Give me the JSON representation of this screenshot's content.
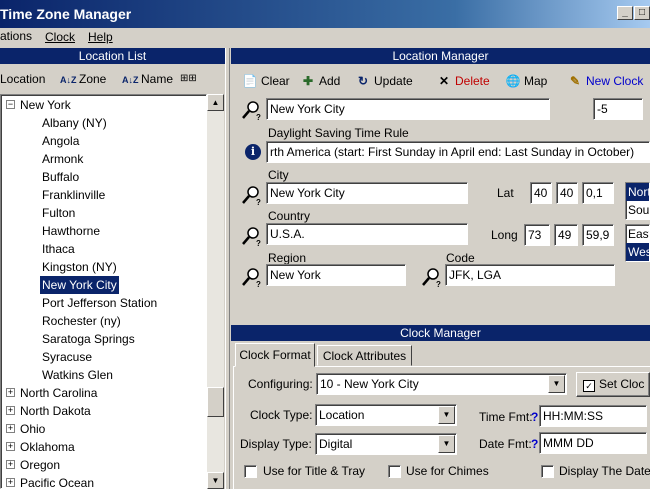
{
  "window": {
    "title": "Time Zone Manager",
    "min": "_",
    "max": "□",
    "close": "×"
  },
  "menu": {
    "locations": "ations",
    "clock": "Clock",
    "help": "Help"
  },
  "location_list": {
    "header": "Location List",
    "sort_location": "Location",
    "sort_zone": "Zone",
    "sort_name": "Name",
    "sort_icon": "A↓Z",
    "tree_icon": "⊞⊞",
    "expanded_group": "New York",
    "children": [
      "Albany (NY)",
      "Angola",
      "Armonk",
      "Buffalo",
      "Franklinville",
      "Fulton",
      "Hawthorne",
      "Ithaca",
      "Kingston (NY)",
      "New York City",
      "Port Jefferson Station",
      "Rochester (ny)",
      "Saratoga Springs",
      "Syracuse",
      "Watkins Glen"
    ],
    "selected": "New York City",
    "collapsed_groups": [
      "North Carolina",
      "North Dakota",
      "Ohio",
      "Oklahoma",
      "Oregon",
      "Pacific Ocean"
    ],
    "expand_minus": "−",
    "expand_plus": "+",
    "scroll_up": "▲",
    "scroll_down": "▼"
  },
  "location_manager": {
    "header": "Location Manager",
    "toolbar": {
      "clear": "Clear",
      "add": "Add",
      "update": "Update",
      "delete": "Delete",
      "map": "Map",
      "new_clock": "New Clock"
    },
    "toolbar_icons": {
      "clear": "📄",
      "add": "✚",
      "update": "↻",
      "delete": "✕",
      "map": "🌐",
      "new_clock": "✎"
    },
    "search_value": "New York City",
    "offset_value": "-5",
    "dst_label": "Daylight Saving Time Rule",
    "info_glyph": "i",
    "dst_value": "rth America  (start: First Sunday in April  end: Last Sunday in October)",
    "city_label": "City",
    "city_value": "New York City",
    "country_label": "Country",
    "country_value": "U.S.A.",
    "region_label": "Region",
    "region_value": "New York",
    "code_label": "Code",
    "code_value": "JFK, LGA",
    "lat_label": "Lat",
    "lat": [
      "40",
      "40",
      "0,1"
    ],
    "long_label": "Long",
    "long": [
      "73",
      "49",
      "59,9"
    ],
    "ns": [
      "Nort",
      "Sou"
    ],
    "ew": [
      "East",
      "Wes"
    ],
    "colors": {
      "delete": "#c00000",
      "new_clock": "#0000cc",
      "info": "#0a246a"
    }
  },
  "clock_manager": {
    "header": "Clock Manager",
    "tabs": [
      "Clock Format",
      "Clock Attributes"
    ],
    "configuring_label": "Configuring:",
    "configuring_value": "10 - New York City",
    "set_clock": "Set Cloc",
    "clock_type_label": "Clock Type:",
    "clock_type_value": "Location",
    "display_type_label": "Display Type:",
    "display_type_value": "Digital",
    "time_fmt_label": "Time Fmt:",
    "time_fmt_value": "HH:MM:SS",
    "date_fmt_label": "Date Fmt:",
    "date_fmt_value": "MMM DD",
    "help_glyph": "?",
    "dropdown_glyph": "▼",
    "checkboxes": [
      "Use for Title & Tray",
      "Use for Chimes",
      "Display The Date"
    ]
  },
  "colors": {
    "titlebar": "#0a246a",
    "panel_header": "#0a246a",
    "face": "#d4d0c8",
    "selection": "#0a246a"
  }
}
